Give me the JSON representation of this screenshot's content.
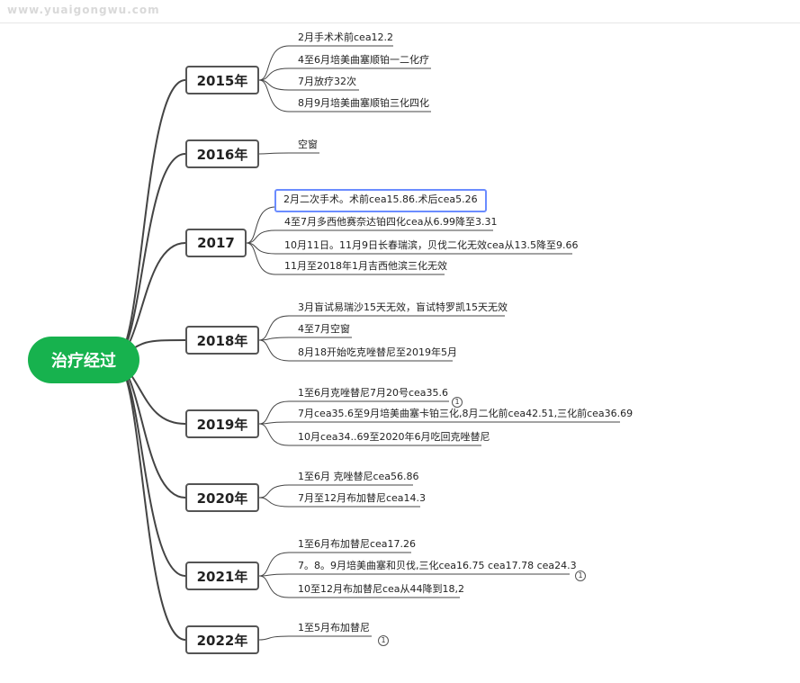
{
  "watermark": "www.yuaigongwu.com",
  "root": {
    "label": "治疗经过"
  },
  "years": [
    {
      "label": "2015年",
      "items": [
        "2月手术术前cea12.2",
        "4至6月培美曲塞顺铂一二化疗",
        "7月放疗32次",
        "8月9月培美曲塞顺铂三化四化"
      ]
    },
    {
      "label": "2016年",
      "items": [
        "空窗"
      ]
    },
    {
      "label": "2017",
      "items": [
        "2月二次手术。术前cea15.86.术后cea5.26",
        "4至7月多西他赛奈达铂四化cea从6.99降至3.31",
        "10月11日。11月9日长春瑞滨，贝伐二化无效cea从13.5降至9.66",
        "11月至2018年1月吉西他滨三化无效"
      ]
    },
    {
      "label": "2018年",
      "items": [
        "3月盲试易瑞沙15天无效，盲试特罗凯15天无效",
        "4至7月空窗",
        "8月18开始吃克唑替尼至2019年5月"
      ]
    },
    {
      "label": "2019年",
      "items": [
        "1至6月克唑替尼7月20号cea35.6",
        "7月cea35.6至9月培美曲塞卡铂三化,8月二化前cea42.51,三化前cea36.69",
        "10月cea34..69至2020年6月吃回克唑替尼"
      ]
    },
    {
      "label": "2020年",
      "items": [
        "1至6月 克唑替尼cea56.86",
        "7月至12月布加替尼cea14.3"
      ]
    },
    {
      "label": "2021年",
      "items": [
        "1至6月布加替尼cea17.26",
        "7。8。9月培美曲塞和贝伐,三化cea16.75   cea17.78   cea24.3",
        "10至12月布加替尼cea从44降到18,2"
      ]
    },
    {
      "label": "2022年",
      "items": [
        "1至5月布加替尼"
      ]
    }
  ],
  "markers": [
    "1",
    "1",
    "1"
  ]
}
